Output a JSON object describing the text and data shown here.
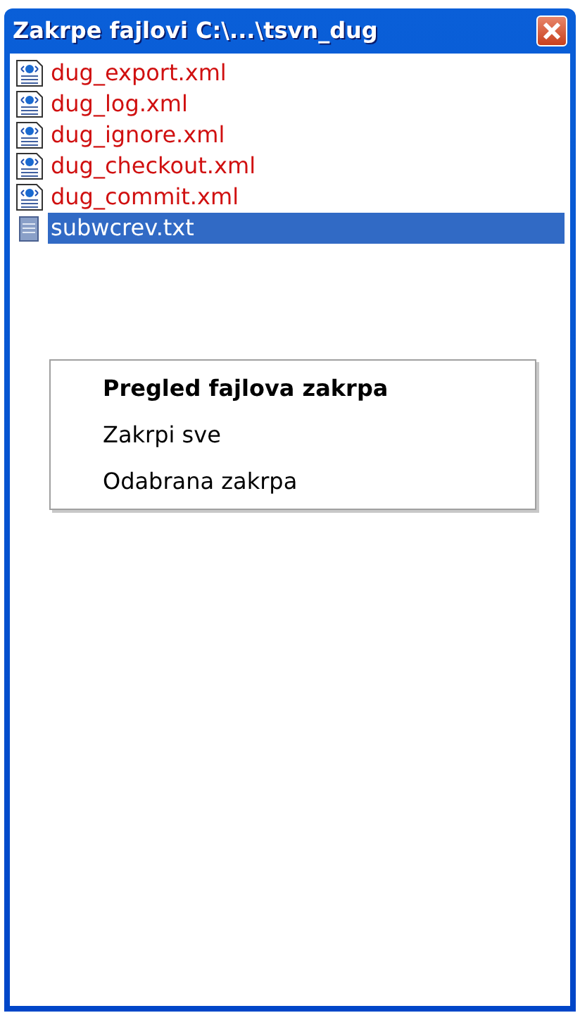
{
  "window": {
    "title": "Zakrpe fajlovi  C:\\...\\tsvn_dug"
  },
  "files": [
    {
      "name": "dug_export.xml",
      "kind": "xml",
      "selected": false
    },
    {
      "name": "dug_log.xml",
      "kind": "xml",
      "selected": false
    },
    {
      "name": "dug_ignore.xml",
      "kind": "xml",
      "selected": false
    },
    {
      "name": "dug_checkout.xml",
      "kind": "xml",
      "selected": false
    },
    {
      "name": "dug_commit.xml",
      "kind": "xml",
      "selected": false
    },
    {
      "name": "subwcrev.txt",
      "kind": "txt",
      "selected": true
    }
  ],
  "context_menu": [
    {
      "label": "Pregled fajlova zakrpa",
      "default": true
    },
    {
      "label": "Zakrpi sve",
      "default": false
    },
    {
      "label": "Odabrana zakrpa",
      "default": false
    }
  ]
}
